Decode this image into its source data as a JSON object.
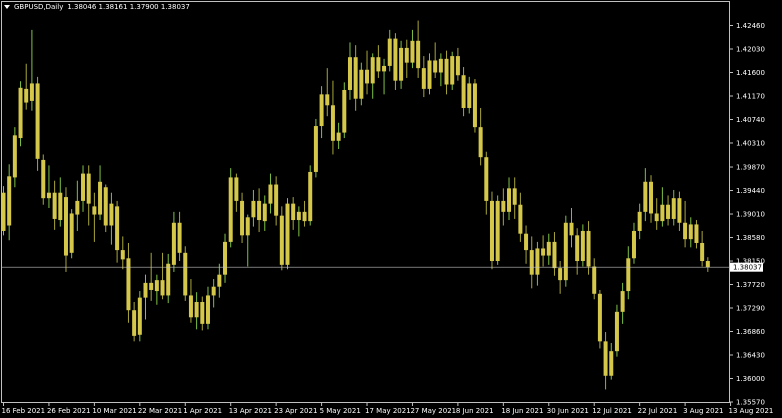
{
  "header": {
    "symbol": "GBPUSD,Daily",
    "ohlc": "1.38046 1.38161 1.37900 1.38037"
  },
  "colors": {
    "background": "#000000",
    "frame": "#c0c0c0",
    "bull": "#d4c74a",
    "bear": "#d4c74a",
    "wick_bull": "#7fc246",
    "wick_bear": "#a9a63a",
    "price_line": "#c0c0c0",
    "text": "#ffffff"
  },
  "chart_data": {
    "type": "candlestick",
    "symbol": "GBPUSD",
    "timeframe": "Daily",
    "y_ticks": [
      "1.42460",
      "1.42030",
      "1.41600",
      "1.41170",
      "1.40740",
      "1.40310",
      "1.39870",
      "1.39440",
      "1.39010",
      "1.38580",
      "1.38150",
      "1.37720",
      "1.37290",
      "1.36860",
      "1.36430",
      "1.36000",
      "1.35570"
    ],
    "ylim": [
      1.3557,
      1.4289
    ],
    "current_price": "1.38037",
    "x_ticks": [
      {
        "label": "16 Feb 2021",
        "bar": 0
      },
      {
        "label": "26 Feb 2021",
        "bar": 8
      },
      {
        "label": "10 Mar 2021",
        "bar": 16
      },
      {
        "label": "22 Mar 2021",
        "bar": 24
      },
      {
        "label": "1 Apr 2021",
        "bar": 32
      },
      {
        "label": "13 Apr 2021",
        "bar": 40
      },
      {
        "label": "23 Apr 2021",
        "bar": 48
      },
      {
        "label": "5 May 2021",
        "bar": 56
      },
      {
        "label": "17 May 2021",
        "bar": 64
      },
      {
        "label": "27 May 2021",
        "bar": 72
      },
      {
        "label": "8 Jun 2021",
        "bar": 80
      },
      {
        "label": "18 Jun 2021",
        "bar": 88
      },
      {
        "label": "30 Jun 2021",
        "bar": 96
      },
      {
        "label": "12 Jul 2021",
        "bar": 104
      },
      {
        "label": "22 Jul 2021",
        "bar": 112
      },
      {
        "label": "3 Aug 2021",
        "bar": 120
      },
      {
        "label": "13 Aug 2021",
        "bar": 128
      }
    ],
    "candles": [
      [
        1.387,
        1.3952,
        1.3862,
        1.394
      ],
      [
        1.388,
        1.3992,
        1.3853,
        1.397
      ],
      [
        1.3968,
        1.406,
        1.395,
        1.4045
      ],
      [
        1.404,
        1.4144,
        1.4025,
        1.4132
      ],
      [
        1.413,
        1.4176,
        1.4092,
        1.4105
      ],
      [
        1.4108,
        1.4238,
        1.409,
        1.414
      ],
      [
        1.414,
        1.4152,
        1.398,
        1.4002
      ],
      [
        1.4,
        1.401,
        1.3918,
        1.393
      ],
      [
        1.393,
        1.399,
        1.3912,
        1.394
      ],
      [
        1.394,
        1.3962,
        1.3872,
        1.3892
      ],
      [
        1.389,
        1.3968,
        1.3878,
        1.394
      ],
      [
        1.3932,
        1.395,
        1.3795,
        1.3825
      ],
      [
        1.383,
        1.391,
        1.382,
        1.3902
      ],
      [
        1.39,
        1.3962,
        1.387,
        1.3925
      ],
      [
        1.3925,
        1.399,
        1.3905,
        1.3975
      ],
      [
        1.3975,
        1.399,
        1.388,
        1.392
      ],
      [
        1.3915,
        1.394,
        1.385,
        1.39
      ],
      [
        1.39,
        1.399,
        1.389,
        1.396
      ],
      [
        1.395,
        1.3955,
        1.3868,
        1.388
      ],
      [
        1.388,
        1.394,
        1.3845,
        1.392
      ],
      [
        1.3915,
        1.3925,
        1.3812,
        1.3835
      ],
      [
        1.3835,
        1.386,
        1.38,
        1.3818
      ],
      [
        1.382,
        1.3848,
        1.3702,
        1.3725
      ],
      [
        1.3725,
        1.374,
        1.3668,
        1.3678
      ],
      [
        1.368,
        1.376,
        1.3668,
        1.3748
      ],
      [
        1.3748,
        1.379,
        1.3708,
        1.3775
      ],
      [
        1.3775,
        1.383,
        1.3742,
        1.3762
      ],
      [
        1.376,
        1.379,
        1.3735,
        1.378
      ],
      [
        1.378,
        1.383,
        1.3745,
        1.3752
      ],
      [
        1.3752,
        1.3828,
        1.3738,
        1.381
      ],
      [
        1.3808,
        1.3905,
        1.3795,
        1.3885
      ],
      [
        1.3885,
        1.3905,
        1.3815,
        1.383
      ],
      [
        1.383,
        1.3842,
        1.3742,
        1.3752
      ],
      [
        1.3752,
        1.3782,
        1.3702,
        1.3712
      ],
      [
        1.3712,
        1.3758,
        1.369,
        1.374
      ],
      [
        1.374,
        1.375,
        1.3688,
        1.37
      ],
      [
        1.37,
        1.3768,
        1.369,
        1.3752
      ],
      [
        1.3752,
        1.3782,
        1.373,
        1.3768
      ],
      [
        1.3768,
        1.381,
        1.3748,
        1.379
      ],
      [
        1.379,
        1.3865,
        1.3775,
        1.385
      ],
      [
        1.385,
        1.3985,
        1.384,
        1.3968
      ],
      [
        1.3968,
        1.3975,
        1.3905,
        1.3925
      ],
      [
        1.3925,
        1.394,
        1.3848,
        1.3862
      ],
      [
        1.3862,
        1.39,
        1.3805,
        1.3895
      ],
      [
        1.3895,
        1.3945,
        1.3878,
        1.3925
      ],
      [
        1.3925,
        1.3948,
        1.3868,
        1.389
      ],
      [
        1.3888,
        1.3935,
        1.387,
        1.392
      ],
      [
        1.392,
        1.3975,
        1.3902,
        1.3955
      ],
      [
        1.3955,
        1.397,
        1.388,
        1.3898
      ],
      [
        1.3898,
        1.3915,
        1.3798,
        1.3808
      ],
      [
        1.3808,
        1.393,
        1.38,
        1.392
      ],
      [
        1.392,
        1.3932,
        1.3872,
        1.389
      ],
      [
        1.389,
        1.3915,
        1.386,
        1.3905
      ],
      [
        1.3905,
        1.3925,
        1.3878,
        1.3888
      ],
      [
        1.3888,
        1.399,
        1.388,
        1.3978
      ],
      [
        1.3978,
        1.4075,
        1.3968,
        1.4062
      ],
      [
        1.4062,
        1.4135,
        1.404,
        1.412
      ],
      [
        1.412,
        1.4168,
        1.408,
        1.41
      ],
      [
        1.41,
        1.4145,
        1.401,
        1.4035
      ],
      [
        1.4035,
        1.4068,
        1.402,
        1.405
      ],
      [
        1.405,
        1.4142,
        1.404,
        1.4128
      ],
      [
        1.4128,
        1.4215,
        1.411,
        1.4188
      ],
      [
        1.4188,
        1.421,
        1.409,
        1.4112
      ],
      [
        1.4112,
        1.4178,
        1.41,
        1.4165
      ],
      [
        1.4165,
        1.42,
        1.412,
        1.414
      ],
      [
        1.414,
        1.4195,
        1.4112,
        1.4188
      ],
      [
        1.4188,
        1.421,
        1.415,
        1.4162
      ],
      [
        1.4162,
        1.4185,
        1.412,
        1.4172
      ],
      [
        1.4172,
        1.4238,
        1.4162,
        1.4222
      ],
      [
        1.4222,
        1.4232,
        1.4128,
        1.4145
      ],
      [
        1.4145,
        1.4218,
        1.413,
        1.4205
      ],
      [
        1.4205,
        1.422,
        1.415,
        1.4178
      ],
      [
        1.4178,
        1.4238,
        1.4168,
        1.4218
      ],
      [
        1.4218,
        1.4255,
        1.415,
        1.4168
      ],
      [
        1.4168,
        1.419,
        1.4115,
        1.413
      ],
      [
        1.413,
        1.4195,
        1.412,
        1.4182
      ],
      [
        1.4182,
        1.4215,
        1.415,
        1.416
      ],
      [
        1.416,
        1.4195,
        1.4135,
        1.4185
      ],
      [
        1.4185,
        1.42,
        1.412,
        1.4138
      ],
      [
        1.4138,
        1.4198,
        1.4128,
        1.419
      ],
      [
        1.419,
        1.4205,
        1.4145,
        1.4155
      ],
      [
        1.4155,
        1.417,
        1.408,
        1.4095
      ],
      [
        1.4095,
        1.4152,
        1.4085,
        1.414
      ],
      [
        1.414,
        1.4148,
        1.405,
        1.406
      ],
      [
        1.406,
        1.4095,
        1.399,
        1.4005
      ],
      [
        1.4005,
        1.4015,
        1.39,
        1.3925
      ],
      [
        1.3925,
        1.3942,
        1.38,
        1.3815
      ],
      [
        1.3815,
        1.3935,
        1.3808,
        1.3925
      ],
      [
        1.3925,
        1.3948,
        1.388,
        1.3905
      ],
      [
        1.3905,
        1.3968,
        1.389,
        1.3948
      ],
      [
        1.3948,
        1.3968,
        1.3892,
        1.3918
      ],
      [
        1.3918,
        1.394,
        1.385,
        1.3865
      ],
      [
        1.3865,
        1.388,
        1.381,
        1.3835
      ],
      [
        1.3835,
        1.386,
        1.3765,
        1.379
      ],
      [
        1.379,
        1.385,
        1.377,
        1.3838
      ],
      [
        1.3838,
        1.3862,
        1.3805,
        1.3825
      ],
      [
        1.3825,
        1.3865,
        1.3808,
        1.385
      ],
      [
        1.385,
        1.3868,
        1.3788,
        1.3802
      ],
      [
        1.3802,
        1.3815,
        1.3755,
        1.378
      ],
      [
        1.378,
        1.3898,
        1.3768,
        1.3885
      ],
      [
        1.3885,
        1.3912,
        1.384,
        1.3862
      ],
      [
        1.3862,
        1.3875,
        1.379,
        1.3815
      ],
      [
        1.3815,
        1.3882,
        1.3805,
        1.387
      ],
      [
        1.387,
        1.3888,
        1.379,
        1.3805
      ],
      [
        1.3805,
        1.382,
        1.3745,
        1.3755
      ],
      [
        1.3755,
        1.3762,
        1.3655,
        1.3668
      ],
      [
        1.3668,
        1.3685,
        1.358,
        1.3605
      ],
      [
        1.3605,
        1.3665,
        1.3598,
        1.365
      ],
      [
        1.365,
        1.3735,
        1.364,
        1.3722
      ],
      [
        1.3722,
        1.3775,
        1.37,
        1.376
      ],
      [
        1.376,
        1.3842,
        1.3745,
        1.382
      ],
      [
        1.382,
        1.3885,
        1.381,
        1.387
      ],
      [
        1.387,
        1.392,
        1.3855,
        1.3905
      ],
      [
        1.3905,
        1.3985,
        1.3888,
        1.396
      ],
      [
        1.396,
        1.3972,
        1.3885,
        1.3902
      ],
      [
        1.3902,
        1.393,
        1.3872,
        1.3888
      ],
      [
        1.3888,
        1.395,
        1.3878,
        1.3918
      ],
      [
        1.3918,
        1.3935,
        1.388,
        1.3892
      ],
      [
        1.3892,
        1.3945,
        1.388,
        1.393
      ],
      [
        1.393,
        1.3942,
        1.387,
        1.3885
      ],
      [
        1.3885,
        1.3925,
        1.384,
        1.3855
      ],
      [
        1.3855,
        1.3895,
        1.384,
        1.3882
      ],
      [
        1.3882,
        1.389,
        1.3838,
        1.3848
      ],
      [
        1.3848,
        1.387,
        1.3805,
        1.3815
      ],
      [
        1.3815,
        1.3822,
        1.3795,
        1.3804
      ]
    ],
    "grid": false,
    "legend": "none"
  }
}
